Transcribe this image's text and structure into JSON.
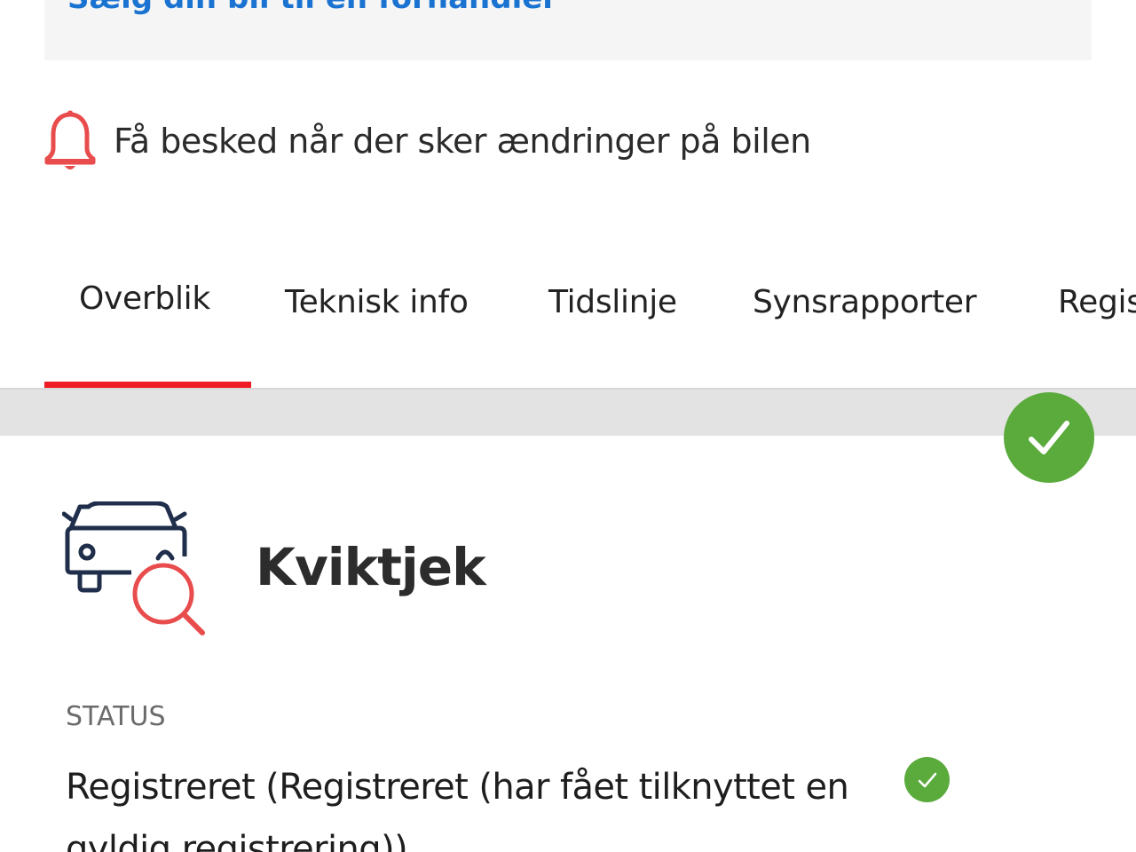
{
  "banner": {
    "sell_text": "Sælg din bil til en forhandler"
  },
  "notification": {
    "icon": "bell-icon",
    "text": "Få besked når der sker ændringer på bilen"
  },
  "tabs": [
    {
      "label": "Overblik",
      "active": true
    },
    {
      "label": "Teknisk info",
      "active": false
    },
    {
      "label": "Tidslinje",
      "active": false
    },
    {
      "label": "Synsrapporter",
      "active": false
    },
    {
      "label": "Registrering",
      "active": false
    }
  ],
  "quickcheck": {
    "title": "Kviktjek",
    "icon": "car-search-icon"
  },
  "status": {
    "label": "STATUS",
    "value": "Registreret (Registreret (har fået tilknyttet en gyldig registrering))"
  },
  "colors": {
    "accent_red": "#ee1c24",
    "ok_green": "#5aab3c",
    "link_blue": "#1a73d1"
  }
}
